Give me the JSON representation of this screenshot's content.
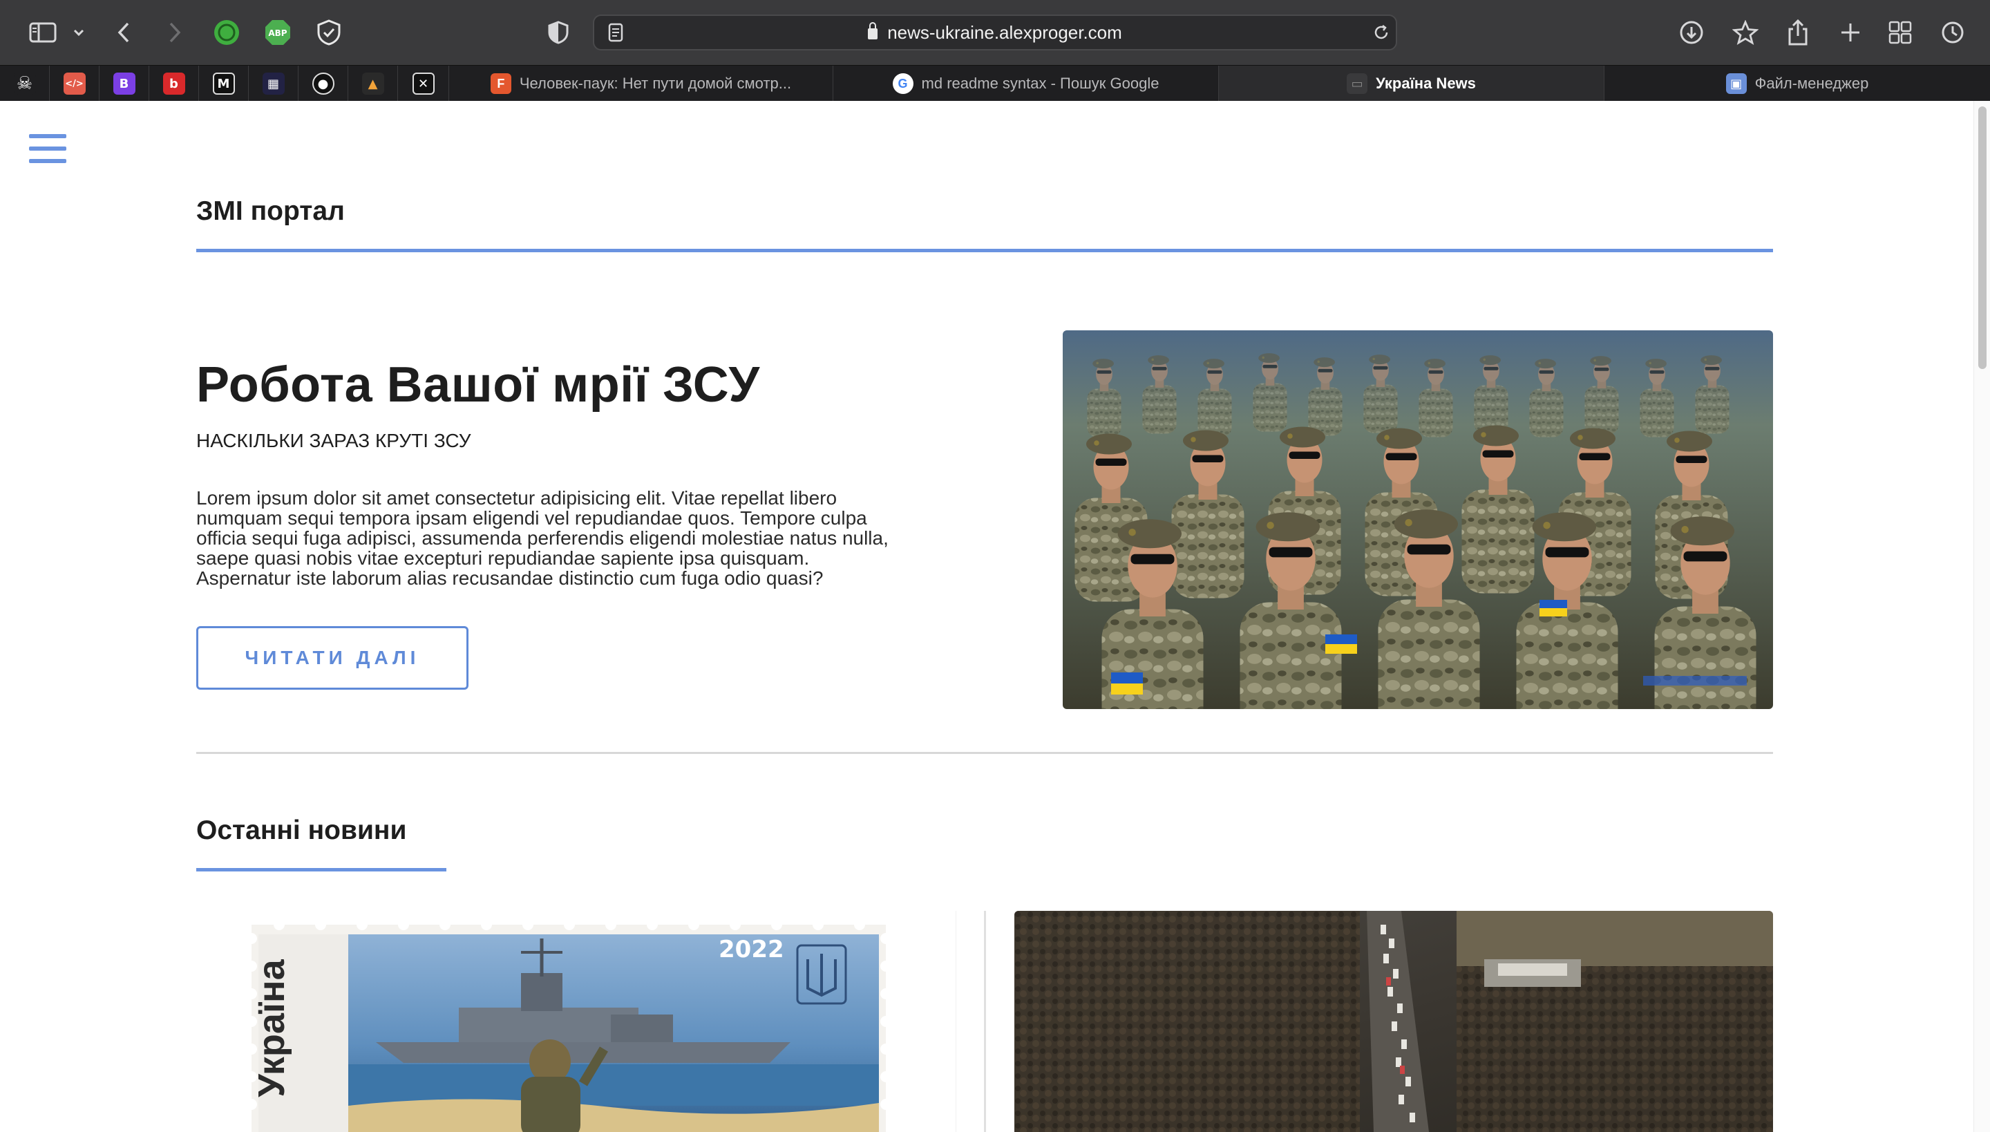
{
  "browser": {
    "url": "news-ukraine.alexproger.com",
    "pinned_tabs": [
      {
        "icon": "pirate-skull-icon",
        "glyph": "☠",
        "color": "#1f1f21"
      },
      {
        "icon": "code-tag-icon",
        "glyph": "</>",
        "color": "#e25b4a"
      },
      {
        "icon": "bootstrap-icon",
        "glyph": "B",
        "color": "#7b3fe4"
      },
      {
        "icon": "red-app-icon",
        "glyph": "b",
        "color": "#d9292b"
      },
      {
        "icon": "medium-icon",
        "glyph": "M",
        "color": "#111111"
      },
      {
        "icon": "film-clapper-icon",
        "glyph": "▦",
        "color": "#222244"
      },
      {
        "icon": "github-icon",
        "glyph": "●",
        "color": "#111111"
      },
      {
        "icon": "colorful-logo-icon",
        "glyph": "▲",
        "color": "#2a2a2a"
      },
      {
        "icon": "grid-x-icon",
        "glyph": "✕",
        "color": "#111111"
      }
    ],
    "tabs": [
      {
        "label": "Человек-паук: Нет пути домой смотр...",
        "icon": "f-logo-icon",
        "fav_glyph": "F",
        "fav_color": "#e4572e",
        "active": false
      },
      {
        "label": "md readme syntax - Пошук Google",
        "icon": "google-icon",
        "fav_glyph": "G",
        "fav_color": "#ffffff",
        "active": false
      },
      {
        "label": "Україна News",
        "icon": "monitor-icon",
        "fav_glyph": "▭",
        "fav_color": "#3a3a3c",
        "active": true
      },
      {
        "label": "Файл-менеджер",
        "icon": "file-manager-icon",
        "fav_glyph": "▣",
        "fav_color": "#6a8fd8",
        "active": false
      }
    ]
  },
  "page": {
    "portal_title": "ЗМІ портал",
    "hero": {
      "title": "Робота Вашої мрії ЗСУ",
      "subtitle": "НАСКІЛЬКИ ЗАРАЗ КРУТІ ЗСУ",
      "text": "Lorem ipsum dolor sit amet consectetur adipisicing elit. Vitae repellat libero numquam sequi tempora ipsam eligendi vel repudiandae quos. Tempore culpa officia sequi fuga adipisci, assumenda perferendis eligendi molestiae natus nulla, saepe quasi nobis vitae excepturi repudiandae sapiente ipsa quisquam. Aspernatur iste laborum alias recusandae distinctio cum fuga odio quasi?",
      "button_label": "ЧИТАТИ ДАЛІ"
    },
    "latest_title": "Останні новини",
    "stamp": {
      "country": "Україна",
      "year": "2022"
    }
  },
  "colors": {
    "accent": "#6a93e0",
    "toolbar": "#3a3a3c",
    "tabbar": "#1f1f21"
  }
}
